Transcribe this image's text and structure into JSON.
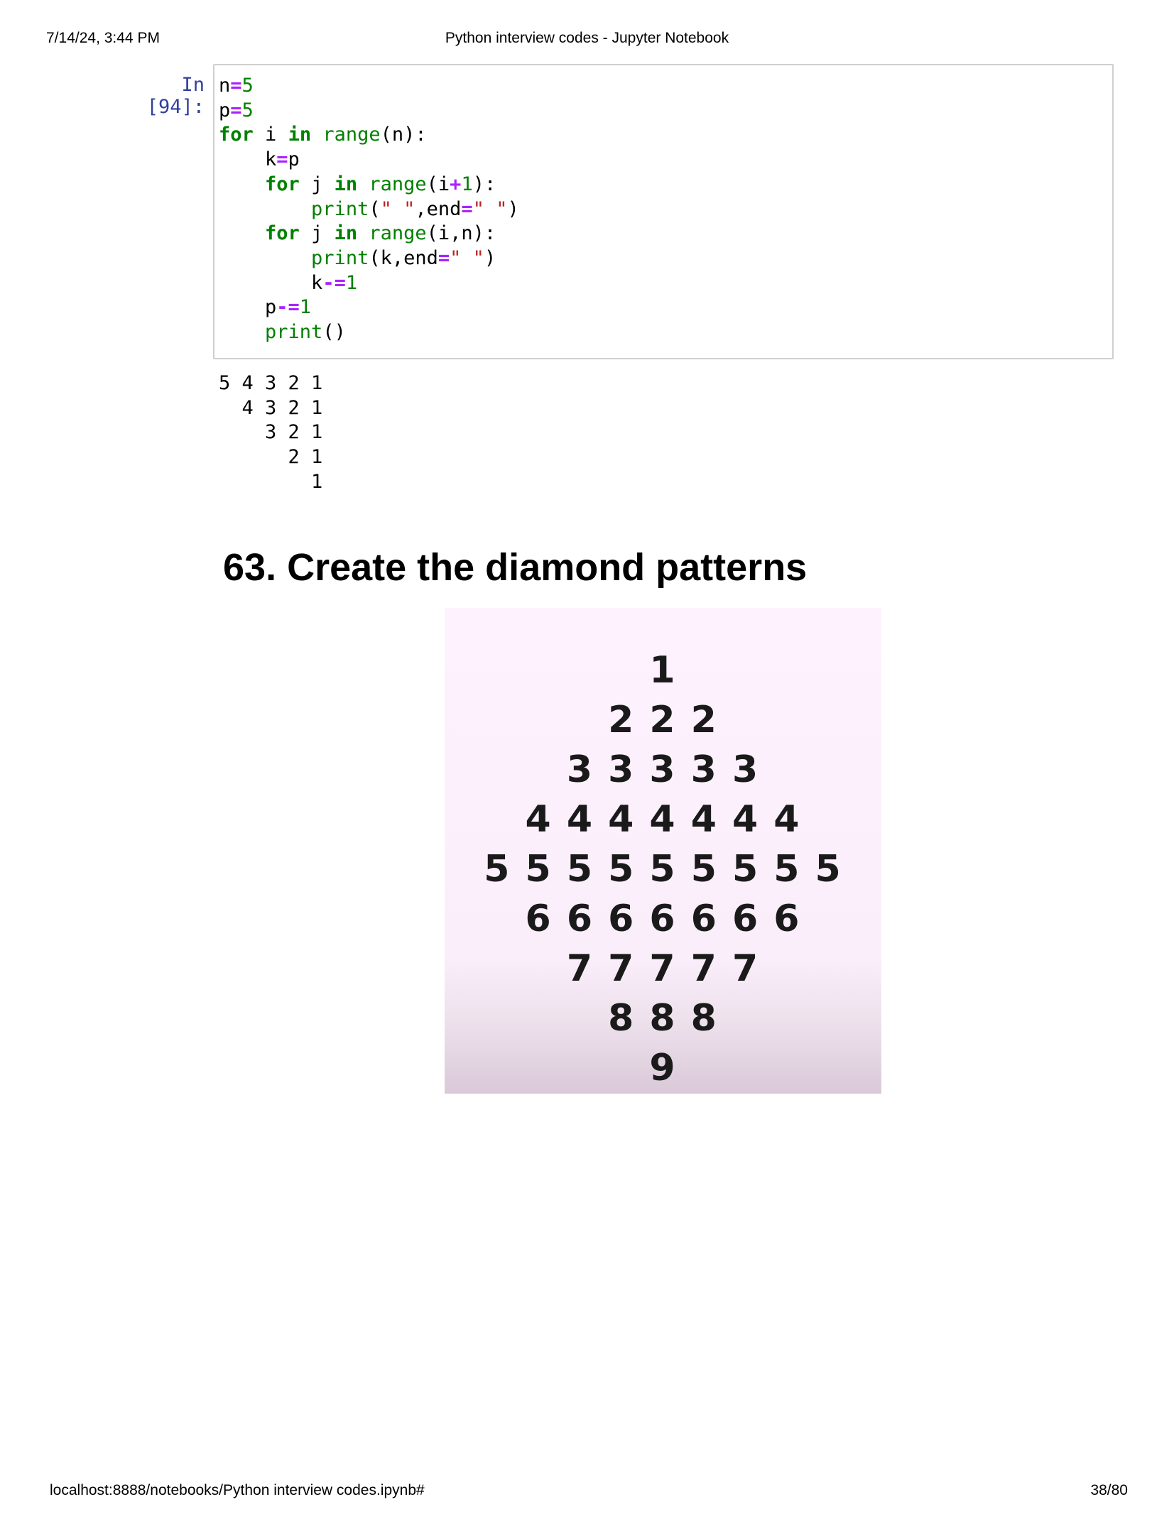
{
  "header": {
    "datetime": "7/14/24, 3:44 PM",
    "title": "Python interview codes - Jupyter Notebook"
  },
  "cell": {
    "prompt": "In [94]:",
    "tokens": {
      "n": "n",
      "p": "p",
      "eq": "=",
      "five": "5",
      "for": "for",
      "in": "in",
      "range": "range",
      "print": "print",
      "minus_eq": "-=",
      "plus": "+",
      "one": "1",
      "space_str": "\" \"",
      "end": "end"
    }
  },
  "output": {
    "lines": [
      "5 4 3 2 1",
      "  4 3 2 1",
      "    3 2 1",
      "      2 1",
      "        1"
    ]
  },
  "section": {
    "heading": "63. Create the diamond patterns"
  },
  "pattern_image": {
    "rows": [
      "1",
      "2 2 2",
      "3 3 3 3 3",
      "4 4 4 4 4 4 4",
      "5 5 5 5 5 5 5 5 5",
      "6 6 6 6 6 6 6",
      "7 7 7 7 7",
      "8 8 8",
      "9"
    ]
  },
  "footer": {
    "url": "localhost:8888/notebooks/Python interview codes.ipynb#",
    "page": "38/80"
  },
  "colors": {
    "prompt": "#303f9f",
    "keyword": "#008000",
    "operator": "#aa22ff",
    "string": "#ba2121",
    "cell_border": "#cfcfcf",
    "pattern_background": "#fdf2fd"
  }
}
